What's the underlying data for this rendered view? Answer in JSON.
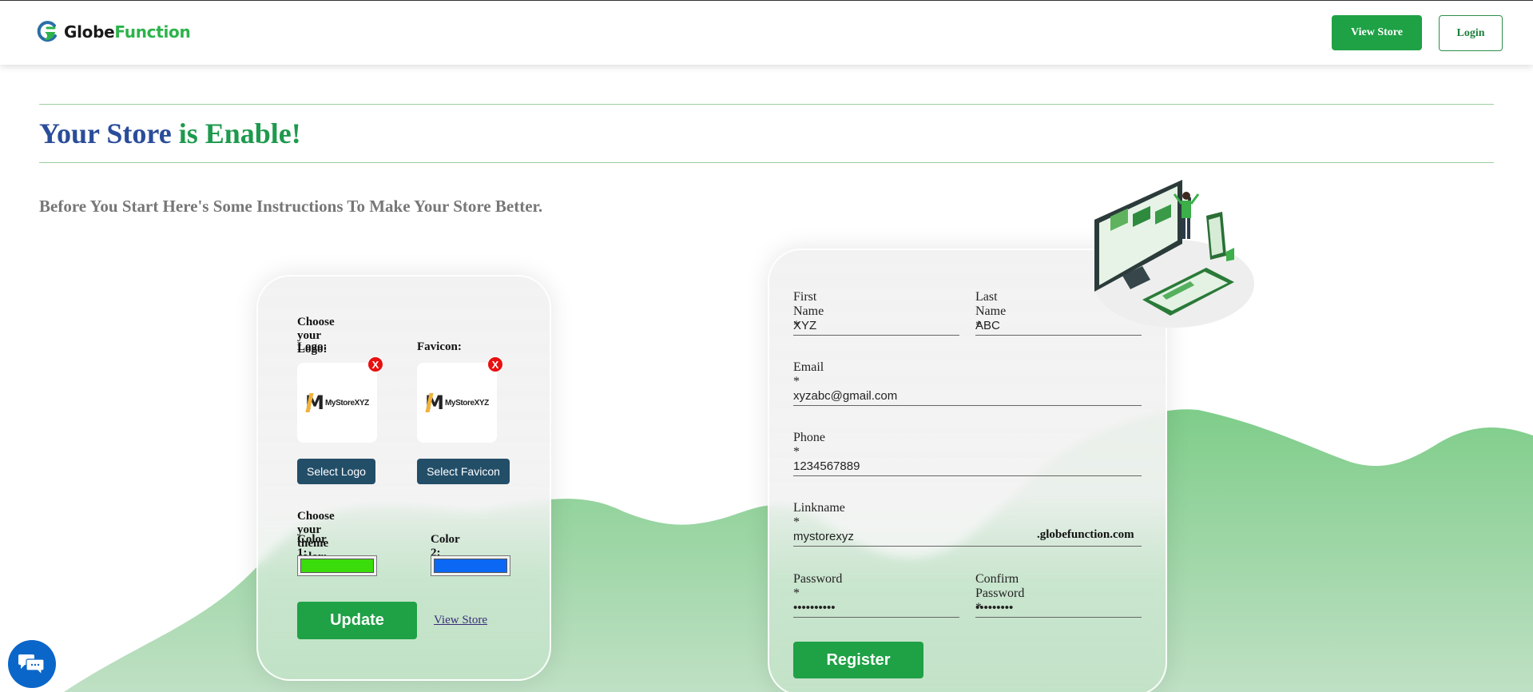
{
  "header": {
    "brand_part1": "Globe",
    "brand_part2": "Function",
    "view_store_label": "View Store",
    "login_label": "Login"
  },
  "hero": {
    "title_part1": "Your Store",
    "title_part2": " is Enable!",
    "subtitle": "Before You Start Here's Some Instructions To Make Your Store Better."
  },
  "customize_card": {
    "logo_section_label": "Choose your Logo:",
    "logo_label": "Logo:",
    "favicon_label": "Favicon:",
    "logo_image_text": "MyStoreXYZ",
    "favicon_image_text": "MyStoreXYZ",
    "remove_icon": "X",
    "select_logo_label": "Select Logo",
    "select_favicon_label": "Select Favicon",
    "theme_section_label": "Choose your theme color:",
    "color1_label": "Color 1:",
    "color2_label": "Color 2:",
    "color1_value": "#3bdc0b",
    "color2_value": "#0a68f5",
    "update_label": "Update",
    "view_store_link": "View Store"
  },
  "register_card": {
    "first_name_label": "First Name *",
    "first_name_value": "XYZ",
    "last_name_label": "Last Name *",
    "last_name_value": "ABC",
    "email_label": "Email *",
    "email_value": "xyzabc@gmail.com",
    "phone_label": "Phone *",
    "phone_value": "1234567889",
    "linkname_label": "Linkname *",
    "linkname_value": "mystorexyz",
    "linkname_suffix": ".globefunction.com",
    "password_label": "Password *",
    "password_value": "mypassword",
    "confirm_password_label": "Confirm Password *",
    "confirm_password_value": "mypasswor",
    "register_label": "Register"
  },
  "icons": {
    "brand": "globefunction-logo-icon",
    "chat": "chat-bubbles-icon",
    "illustration": "devices-illustration"
  },
  "colors": {
    "brand_green": "#1fa145",
    "title_blue": "#2a4d9a",
    "select_button": "#234e68",
    "chat_blue": "#0b66c9",
    "remove_red": "#e81010"
  }
}
